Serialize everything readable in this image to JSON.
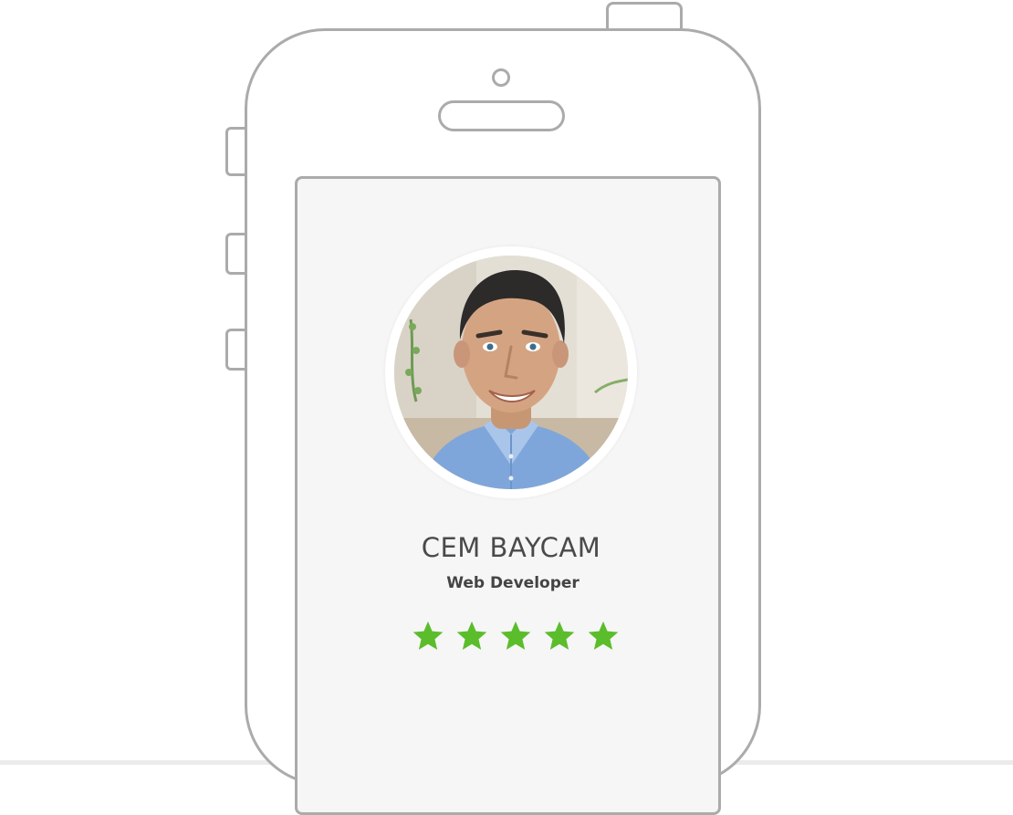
{
  "profile": {
    "name": "CEM BAYCAM",
    "role": "Web Developer",
    "avatar_icon": "user-photo",
    "rating": {
      "value": 5,
      "max": 5,
      "icon": "star-icon",
      "color": "#5bbd2b"
    }
  },
  "device": {
    "frame_color": "#ababab",
    "screen_color": "#f6f6f6"
  }
}
